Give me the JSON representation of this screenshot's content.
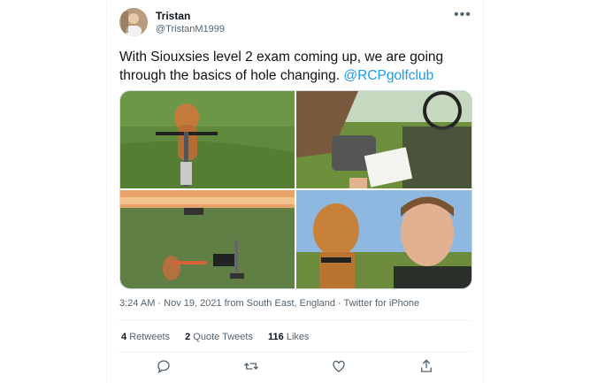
{
  "user": {
    "name": "Tristan",
    "handle": "@TristanM1999"
  },
  "tweet": {
    "text": "With Siouxsies level 2 exam coming up, we are going through the basics of hole changing.",
    "mention": "@RCPgolfclub"
  },
  "meta": {
    "timestamp": "3:24 AM · Nov 19, 2021 from South East, England · Twitter for iPhone"
  },
  "stats": {
    "retweets_count": "4",
    "retweets_label": "Retweets",
    "quotes_count": "2",
    "quotes_label": "Quote Tweets",
    "likes_count": "116",
    "likes_label": "Likes"
  },
  "actions": {
    "reply_icon": "reply-icon",
    "retweet_icon": "retweet-icon",
    "like_icon": "heart-icon",
    "share_icon": "share-icon"
  },
  "colors": {
    "accent": "#1d9bf0",
    "text": "#0f1419",
    "muted": "#536471"
  }
}
